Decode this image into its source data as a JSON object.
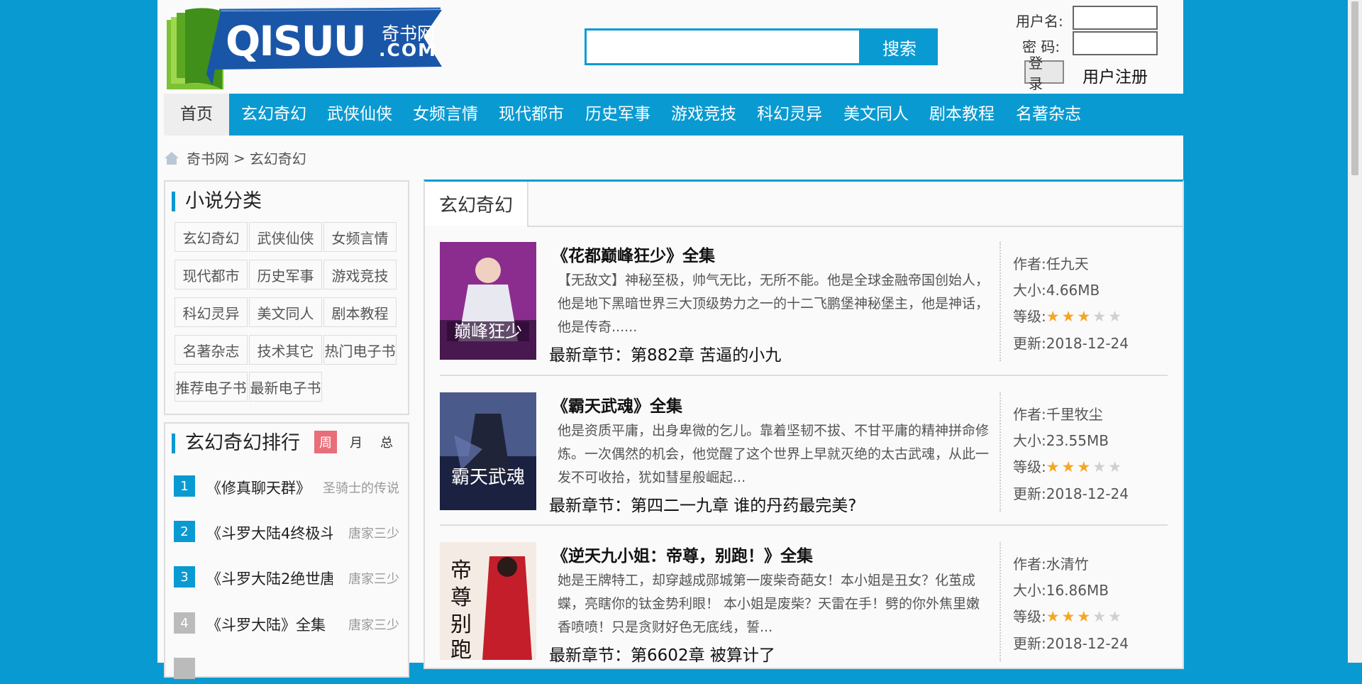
{
  "header": {
    "logo": {
      "main": "QISUU",
      "cn": "奇书网",
      "dot": ".COM"
    },
    "search_button": "搜索",
    "username_label": "用户名:",
    "password_label": "密 码:",
    "login_button": "登录",
    "register": "用户注册"
  },
  "nav": [
    "首页",
    "玄幻奇幻",
    "武侠仙侠",
    "女频言情",
    "现代都市",
    "历史军事",
    "游戏竞技",
    "科幻灵异",
    "美文同人",
    "剧本教程",
    "名著杂志"
  ],
  "breadcrumb": {
    "home": "奇书网",
    "sep": ">",
    "current": "玄幻奇幻"
  },
  "categories": {
    "title": "小说分类",
    "items": [
      "玄幻奇幻",
      "武侠仙侠",
      "女频言情",
      "现代都市",
      "历史军事",
      "游戏竞技",
      "科幻灵异",
      "美文同人",
      "剧本教程",
      "名著杂志",
      "技术其它",
      "热门电子书",
      "推荐电子书",
      "最新电子书"
    ]
  },
  "ranking": {
    "title": "玄幻奇幻排行",
    "tabs": [
      "周",
      "月",
      "总"
    ],
    "items": [
      {
        "num": "1",
        "title": "《修真聊天群》",
        "author": "圣骑士的传说"
      },
      {
        "num": "2",
        "title": "《斗罗大陆4终极斗",
        "author": "唐家三少"
      },
      {
        "num": "3",
        "title": "《斗罗大陆2绝世唐",
        "author": "唐家三少"
      },
      {
        "num": "4",
        "title": "《斗罗大陆》全集",
        "author": "唐家三少"
      }
    ]
  },
  "main": {
    "tab": "玄幻奇幻",
    "labels": {
      "author": "作者:",
      "size": "大小:",
      "level": "等级:",
      "updated": "更新:"
    },
    "books": [
      {
        "title": "《花都巅峰狂少》全集",
        "desc": "【无敌文】神秘至极，帅气无比，无所不能。他是全球金融帝国创始人，他是地下黑暗世界三大顶级势力之一的十二飞鹏堡神秘堡主，他是神话，他是传奇......",
        "latest": "最新章节：第882章 苦逼的小九",
        "author": "任九天",
        "size": "4.66MB",
        "rating": 3,
        "updated": "2018-12-24",
        "cover_color": "#7a2a7a"
      },
      {
        "title": "《霸天武魂》全集",
        "desc": "他是资质平庸，出身卑微的乞儿。靠着坚韧不拔、不甘平庸的精神拼命修炼。一次偶然的机会，他觉醒了这个世界上早就灭绝的太古武魂，从此一发不可收拾，犹如彗星般崛起...",
        "latest": "最新章节：第四二一九章 谁的丹药最完美?",
        "author": "千里牧尘",
        "size": "23.55MB",
        "rating": 3,
        "updated": "2018-12-24",
        "cover_color": "#2a3560"
      },
      {
        "title": "《逆天九小姐：帝尊，别跑！》全集",
        "desc": "她是王牌特工，却穿越成郧城第一废柴奇葩女！本小姐是丑女？化茧成蝶，亮瞎你的钛金势利眼！ 本小姐是废柴？天雷在手！劈的你外焦里嫩香喷喷！只是贪财好色无底线，誓...",
        "latest": "最新章节：第6602章 被算计了",
        "author": "水清竹",
        "size": "16.86MB",
        "rating": 3,
        "updated": "2018-12-24",
        "cover_color": "#b8202a"
      }
    ]
  },
  "colors": {
    "accent": "#0a9ad2",
    "rank_active": "#e86e7a",
    "star": "#f5a623"
  },
  "icons": [
    "home-icon",
    "book-logo-icon",
    "star-icon"
  ]
}
